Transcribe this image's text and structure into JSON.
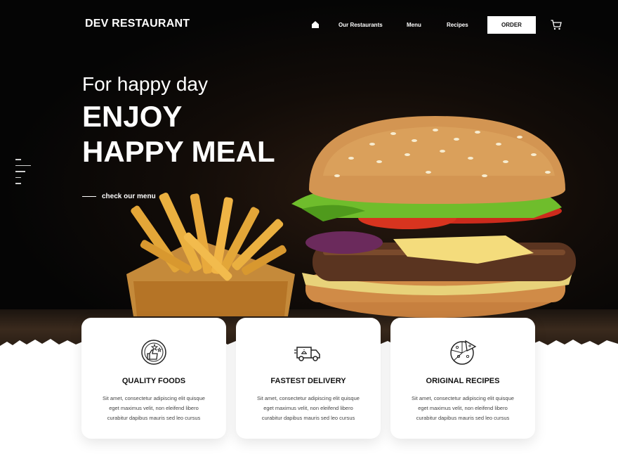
{
  "header": {
    "brand": "DEV RESTAURANT",
    "nav": [
      "Our Restaurants",
      "Menu",
      "Recipes"
    ],
    "order_label": "ORDER"
  },
  "hero": {
    "tagline": "For happy day",
    "headline_1": "ENJOY",
    "headline_2": "HAPPY MEAL",
    "menu_link": "check our menu"
  },
  "features": [
    {
      "icon": "quality-badge-icon",
      "title": "QUALITY FOODS",
      "text_lines": [
        "Sit amet, consectetur adipiscing elit quisque",
        "eget maximus velit, non eleifend libero",
        "curabitur dapibus mauris sed leo cursus"
      ]
    },
    {
      "icon": "delivery-truck-icon",
      "title": "FASTEST DELIVERY",
      "text_lines": [
        "Sit amet, consectetur adipiscing elit quisque",
        "eget maximus velit, non eleifend libero",
        "curabitur dapibus mauris sed leo cursus"
      ]
    },
    {
      "icon": "pizza-icon",
      "title": "ORIGINAL RECIPES",
      "text_lines": [
        "Sit amet, consectetur adipiscing elit quisque",
        "eget maximus velit, non eleifend libero",
        "curabitur dapibus mauris sed leo cursus"
      ]
    }
  ],
  "colors": {
    "background_dark": "#050505",
    "card_bg": "#ffffff",
    "text_light": "#ffffff",
    "text_dark": "#111111"
  }
}
